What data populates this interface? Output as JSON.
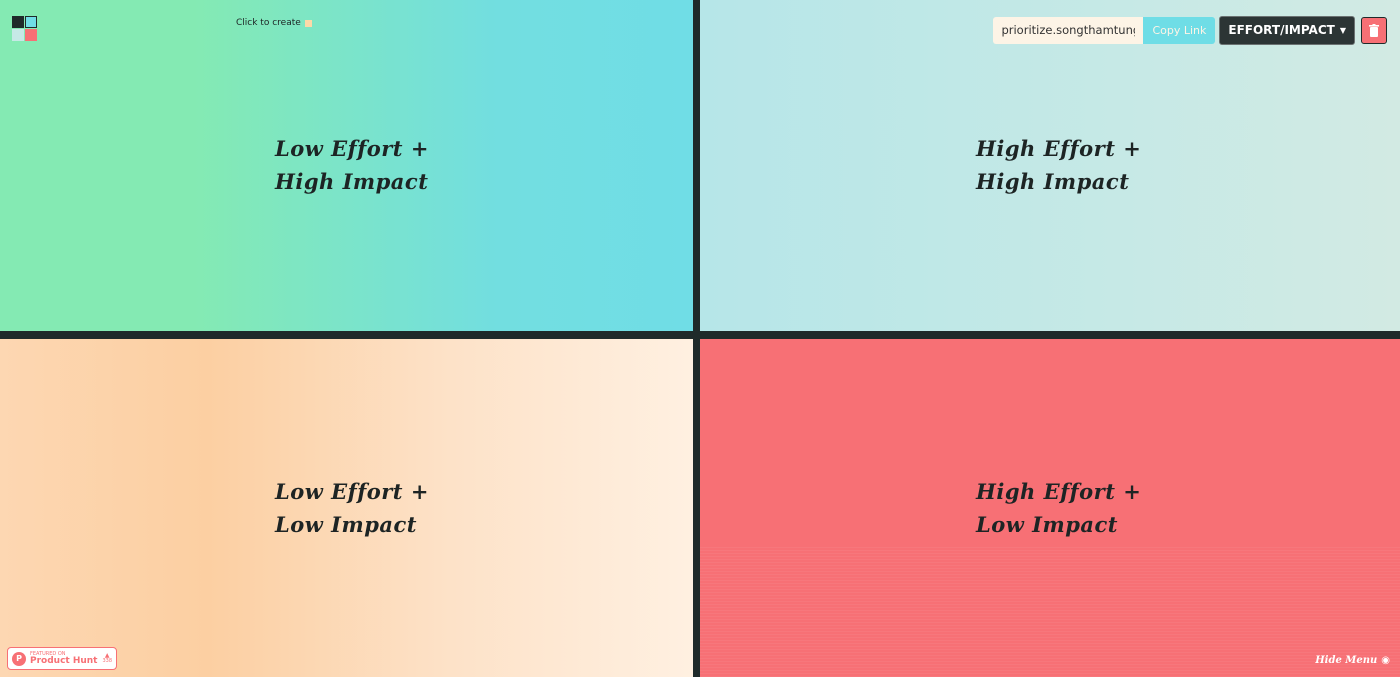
{
  "quadrants": {
    "top_left": {
      "line1": "Low Effort +",
      "line2": "High Impact",
      "color": "#84eab3"
    },
    "top_right": {
      "line1": "High Effort +",
      "line2": "High Impact",
      "color": "#c6e9e6"
    },
    "bottom_left": {
      "line1": "Low Effort +",
      "line2": "Low Impact",
      "color": "#fccfa2"
    },
    "bottom_right": {
      "line1": "High Effort +",
      "line2": "Low Impact",
      "color": "#f77075"
    }
  },
  "header": {
    "click_to_create": "Click to create",
    "url_value": "prioritize.songthamtung.c",
    "copy_link_label": "Copy Link",
    "mode_label": "EFFORT/IMPACT",
    "delete_icon": "trash-icon"
  },
  "footer": {
    "badge_small": "FEATURED ON",
    "badge_name": "Product Hunt",
    "badge_count": "338",
    "hide_menu_label": "Hide Menu"
  }
}
